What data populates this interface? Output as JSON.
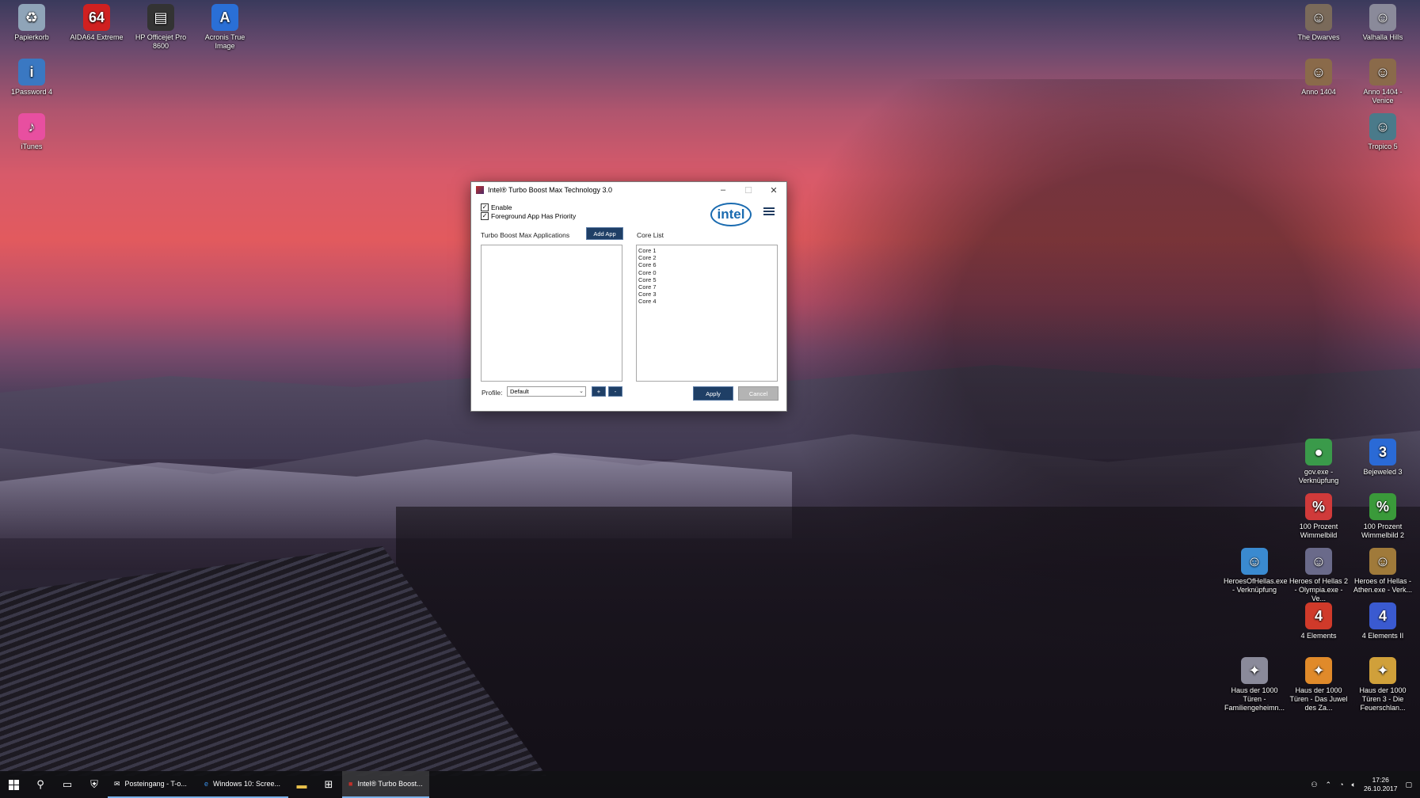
{
  "desktop": {
    "icons_left": [
      {
        "label": "Papierkorb",
        "icon": "recycle-bin-icon",
        "color": "#8fa4b8",
        "glyph": "♻"
      },
      {
        "label": "AIDA64 Extreme",
        "icon": "aida64-icon",
        "color": "#d02020",
        "glyph": "64"
      },
      {
        "label": "HP Officejet Pro 8600",
        "icon": "printer-icon",
        "color": "#333333",
        "glyph": "▤"
      },
      {
        "label": "Acronis True Image",
        "icon": "acronis-icon",
        "color": "#2a6fd6",
        "glyph": "A"
      },
      {
        "label": "1Password 4",
        "icon": "1password-icon",
        "color": "#3a78c2",
        "glyph": "i"
      },
      {
        "label": "iTunes",
        "icon": "itunes-icon",
        "color": "#e84fa0",
        "glyph": "♪"
      }
    ],
    "icons_right": [
      {
        "label": "The Dwarves",
        "icon": "game-icon",
        "color": "#7a6a5a",
        "glyph": "☺"
      },
      {
        "label": "Valhalla Hills",
        "icon": "game-icon",
        "color": "#8a8a9a",
        "glyph": "☺"
      },
      {
        "label": "Anno 1404",
        "icon": "game-icon",
        "color": "#8a6a4a",
        "glyph": "☺"
      },
      {
        "label": "Anno 1404 - Venice",
        "icon": "game-icon",
        "color": "#8a6a4a",
        "glyph": "☺"
      },
      {
        "label": "Tropico 5",
        "icon": "game-icon",
        "color": "#4a7a8a",
        "glyph": "☺"
      },
      {
        "label": "gov.exe - Verknüpfung",
        "icon": "game-icon",
        "color": "#3a9a4a",
        "glyph": "●"
      },
      {
        "label": "Bejeweled 3",
        "icon": "bejeweled-icon",
        "color": "#2a6ad6",
        "glyph": "3"
      },
      {
        "label": "100 Prozent Wimmelbild",
        "icon": "game-icon",
        "color": "#d03a3a",
        "glyph": "%"
      },
      {
        "label": "100 Prozent Wimmelbild 2",
        "icon": "game-icon",
        "color": "#3a9a3a",
        "glyph": "%"
      },
      {
        "label": "HeroesOfHellas.exe - Verknüpfung",
        "icon": "game-icon",
        "color": "#3a8ad0",
        "glyph": "☺"
      },
      {
        "label": "Heroes of Hellas 2 - Olympia.exe - Ve...",
        "icon": "game-icon",
        "color": "#6a6a8a",
        "glyph": "☺"
      },
      {
        "label": "Heroes of Hellas - Athen.exe - Verk...",
        "icon": "game-icon",
        "color": "#a07a3a",
        "glyph": "☺"
      },
      {
        "label": "4 Elements",
        "icon": "game-icon",
        "color": "#d03a2a",
        "glyph": "4"
      },
      {
        "label": "4 Elements II",
        "icon": "game-icon",
        "color": "#3a5ad0",
        "glyph": "4"
      },
      {
        "label": "Haus der 1000 Türen - Familiengeheimn...",
        "icon": "game-icon",
        "color": "#8a8a9a",
        "glyph": "✦"
      },
      {
        "label": "Haus der 1000 Türen - Das Juwel des Za...",
        "icon": "game-icon",
        "color": "#e08a2a",
        "glyph": "✦"
      },
      {
        "label": "Haus der 1000 Türen 3 - Die Feuerschlan...",
        "icon": "game-icon",
        "color": "#d0a03a",
        "glyph": "✦"
      }
    ]
  },
  "dialog": {
    "title": "Intel® Turbo Boost Max Technology 3.0",
    "enable_label": "Enable",
    "enable_checked": true,
    "foreground_label": "Foreground App Has Priority",
    "foreground_checked": true,
    "logo_text": "intel",
    "apps_label": "Turbo Boost Max Applications",
    "add_app_label": "Add App",
    "core_list_label": "Core List",
    "cores": [
      "Core 1",
      "Core 2",
      "Core 6",
      "Core 0",
      "Core 5",
      "Core 7",
      "Core 3",
      "Core 4"
    ],
    "profile_label": "Profile:",
    "profile_value": "Default",
    "add_profile_label": "+",
    "remove_profile_label": "-",
    "apply_label": "Apply",
    "cancel_label": "Cancel"
  },
  "taskbar": {
    "apps": [
      {
        "label": "Posteingang - T-o...",
        "icon": "mail-icon",
        "state": "open"
      },
      {
        "label": "Windows 10: Scree...",
        "icon": "edge-icon",
        "state": "open"
      },
      {
        "label": "Intel® Turbo Boost...",
        "icon": "intel-app-icon",
        "state": "active"
      }
    ],
    "time": "17:26",
    "date": "26.10.2017"
  }
}
